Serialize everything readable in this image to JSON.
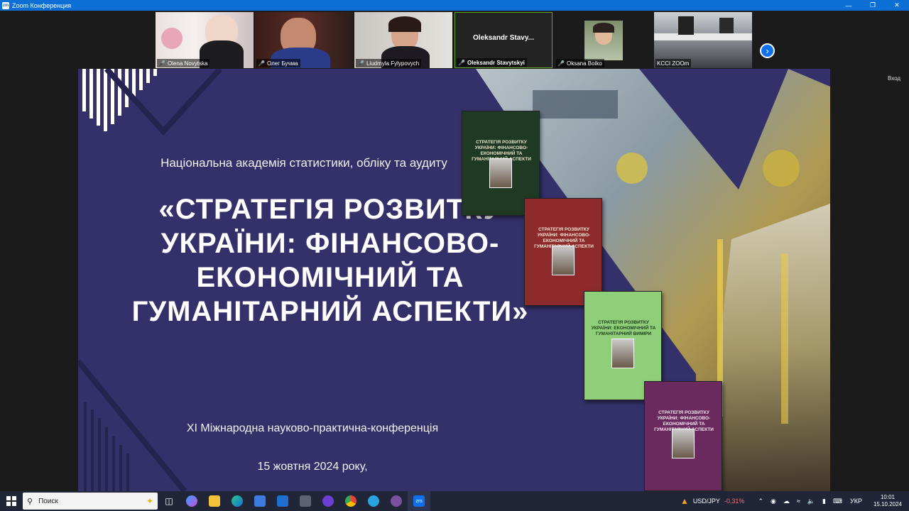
{
  "window": {
    "title": "Zoom Конференция",
    "app_icon_text": "zm"
  },
  "participants": [
    {
      "name": "Olena Novytska"
    },
    {
      "name": "Олег Бучма"
    },
    {
      "name": "Liudmyla Fylypovych"
    },
    {
      "name": "Oleksandr Stavytskyi",
      "center_label": "Oleksandr  Stavy..."
    },
    {
      "name": "Oksana Boiko"
    },
    {
      "name": "KCCI ZOOm"
    }
  ],
  "side_label": "Вход",
  "slide": {
    "academy": "Національна академія статистики, обліку та аудиту",
    "title": "«СТРАТЕГІЯ РОЗВИТКУ УКРАЇНИ: ФІНАНСОВО-ЕКОНОМІЧНИЙ ТА ГУМАНІТАРНИЙ АСПЕКТИ»",
    "conference": "XI Міжнародна науково-практична-конференція",
    "date": "15 жовтня 2024 року,",
    "book_titles": [
      "СТРАТЕГІЯ РОЗВИТКУ УКРАЇНИ: ФІНАНСОВО-ЕКОНОМІЧНИЙ ТА ГУМАНІТАРНИЙ АСПЕКТИ",
      "СТРАТЕГІЯ РОЗВИТКУ УКРАЇНИ: ФІНАНСОВО-ЕКОНОМІЧНИЙ ТА ГУМАНІТАРНИЙ АСПЕКТИ",
      "СТРАТЕГІЯ РОЗВИТКУ УКРАЇНИ: ЕКОНОМІЧНИЙ ТА ГУМАНІТАРНИЙ ВИМІРИ",
      "СТРАТЕГІЯ РОЗВИТКУ УКРАЇНИ: ФІНАНСОВО-ЕКОНОМІЧНИЙ ТА ГУМАНІТАРНИЙ АСПЕКТИ"
    ]
  },
  "taskbar": {
    "search_placeholder": "Поиск",
    "stock_label": "USD/JPY",
    "stock_change": "-0,31%",
    "language": "УКР",
    "time": "10:01",
    "date": "15.10.2024",
    "zoom_label": "zm"
  },
  "colors": {
    "slide_bg": "#34316a",
    "titlebar": "#0b6fd6",
    "taskbar": "#202638"
  }
}
